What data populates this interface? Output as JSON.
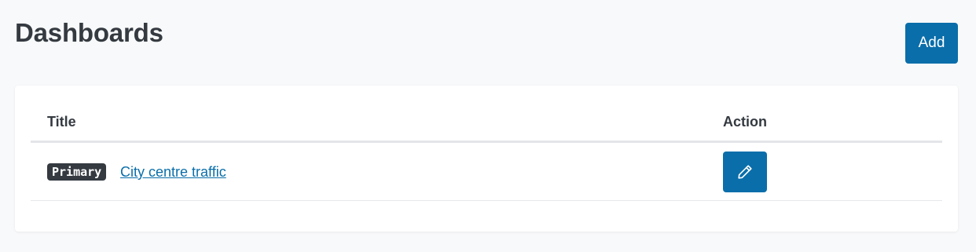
{
  "header": {
    "title": "Dashboards",
    "add_label": "Add"
  },
  "table": {
    "columns": [
      "Title",
      "Action"
    ],
    "rows": [
      {
        "badge": "Primary",
        "title": "City centre traffic",
        "action_icon": "pencil-icon"
      }
    ]
  },
  "colors": {
    "accent": "#0a6eaa",
    "text": "#343a40",
    "badge_bg": "#343a40",
    "page_bg": "#f8f9fa"
  }
}
